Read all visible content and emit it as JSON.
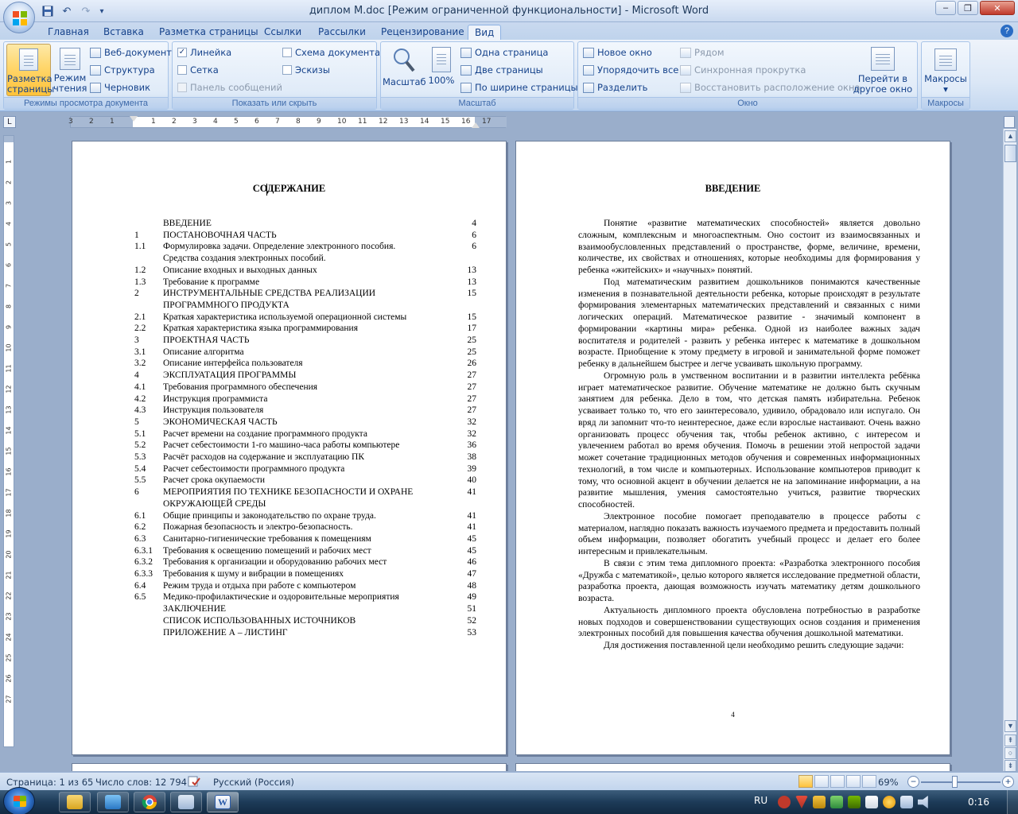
{
  "window": {
    "title": "диплом М.doc [Режим ограниченной функциональности] - Microsoft Word",
    "minimize": "–",
    "maximize": "❐",
    "close": "✕"
  },
  "quick_access": {
    "save_icon": "save-icon",
    "undo": "↶",
    "redo": "↷",
    "customize": "▾"
  },
  "tabs": [
    {
      "label": "Главная"
    },
    {
      "label": "Вставка"
    },
    {
      "label": "Разметка страницы"
    },
    {
      "label": "Ссылки"
    },
    {
      "label": "Рассылки"
    },
    {
      "label": "Рецензирование"
    },
    {
      "label": "Вид",
      "active": true
    }
  ],
  "ribbon": {
    "views": {
      "label": "Режимы просмотра документа",
      "print_layout_l1": "Разметка",
      "print_layout_l2": "страницы",
      "reading_l1": "Режим",
      "reading_l2": "чтения",
      "web": "Веб-документ",
      "outline": "Структура",
      "draft": "Черновик"
    },
    "show": {
      "label": "Показать или скрыть",
      "ruler": "Линейка",
      "ruler_checked": "✓",
      "grid": "Сетка",
      "message_bar": "Панель сообщений",
      "doc_map": "Схема документа",
      "thumbnails": "Эскизы"
    },
    "zoom": {
      "label": "Масштаб",
      "zoom": "Масштаб",
      "hundred": "100%",
      "one_page": "Одна страница",
      "two_pages": "Две страницы",
      "page_width": "По ширине страницы"
    },
    "window": {
      "label": "Окно",
      "new_window": "Новое окно",
      "arrange_all": "Упорядочить все",
      "split": "Разделить",
      "side_by_side": "Рядом",
      "sync_scroll": "Синхронная прокрутка",
      "reset_position": "Восстановить расположение окна",
      "switch_l1": "Перейти в",
      "switch_l2": "другое окно ▾"
    },
    "macros": {
      "label": "Макросы",
      "macros": "Макросы ▾"
    }
  },
  "ruler_corner": "L",
  "toc_page": {
    "title": "СОДЕРЖАНИЕ",
    "entries": [
      {
        "num": "",
        "text": "ВВЕДЕНИЕ",
        "page": "4"
      },
      {
        "num": "1",
        "text": "ПОСТАНОВОЧНАЯ ЧАСТЬ",
        "page": "6"
      },
      {
        "num": "1.1",
        "text": "Формулировка задачи. Определение электронного пособия.",
        "page": "6"
      },
      {
        "num": "",
        "text": "Средства создания электронных пособий.",
        "page": ""
      },
      {
        "num": "1.2",
        "text": "Описание входных и выходных данных",
        "page": "13"
      },
      {
        "num": "1.3",
        "text": "Требование к программе",
        "page": "13"
      },
      {
        "num": "2",
        "text": "ИНСТРУМЕНТАЛЬНЫЕ СРЕДСТВА РЕАЛИЗАЦИИ",
        "page": "15"
      },
      {
        "num": "",
        "text": "ПРОГРАММНОГО ПРОДУКТА",
        "page": ""
      },
      {
        "num": "2.1",
        "text": "Краткая характеристика используемой операционной  системы",
        "page": "15"
      },
      {
        "num": "2.2",
        "text": "Краткая характеристика языка программирования",
        "page": "17"
      },
      {
        "num": "3",
        "text": "ПРОЕКТНАЯ ЧАСТЬ",
        "page": "25"
      },
      {
        "num": "3.1",
        "text": "Описание алгоритма",
        "page": "25"
      },
      {
        "num": "3.2",
        "text": "Описание интерфейса пользователя",
        "page": "26"
      },
      {
        "num": "4",
        "text": "ЭКСПЛУАТАЦИЯ ПРОГРАММЫ",
        "page": "27"
      },
      {
        "num": "4.1",
        "text": "Требования программного обеспечения",
        "page": "27"
      },
      {
        "num": "4.2",
        "text": "Инструкция программиста",
        "page": "27"
      },
      {
        "num": "4.3",
        "text": "Инструкция пользователя",
        "page": "27"
      },
      {
        "num": "5",
        "text": "ЭКОНОМИЧЕСКАЯ ЧАСТЬ",
        "page": "32"
      },
      {
        "num": "5.1",
        "text": "Расчет времени на создание программного продукта",
        "page": "32"
      },
      {
        "num": "5.2",
        "text": "Расчет себестоимости 1-го машино-часа работы компьютере",
        "page": "36"
      },
      {
        "num": "5.3",
        "text": "Расчёт расходов на содержание и эксплуатацию ПК",
        "page": "38"
      },
      {
        "num": "5.4",
        "text": "Расчет себестоимости программного продукта",
        "page": "39"
      },
      {
        "num": "5.5",
        "text": "Расчет срока окупаемости",
        "page": "40"
      },
      {
        "num": "6",
        "text": "МЕРОПРИЯТИЯ ПО ТЕХНИКЕ БЕЗОПАСНОСТИ И ОХРАНЕ",
        "page": "41"
      },
      {
        "num": "",
        "text": "ОКРУЖАЮЩЕЙ СРЕДЫ",
        "page": ""
      },
      {
        "num": "6.1",
        "text": "Общие принципы  и законодательство по охране труда.",
        "page": "41"
      },
      {
        "num": "6.2",
        "text": "Пожарная безопасность и электро-безопасность.",
        "page": "41"
      },
      {
        "num": "6.3",
        "text": "Санитарно-гигиенические требования к помещениям",
        "page": "45"
      },
      {
        "num": "6.3.1",
        "text": "Требования к освещению помещений и рабочих мест",
        "page": "45"
      },
      {
        "num": "6.3.2",
        "text": "Требования к организации и оборудованию рабочих мест",
        "page": "46"
      },
      {
        "num": "6.3.3",
        "text": "Требования к шуму и вибрации в помещениях",
        "page": "47"
      },
      {
        "num": "6.4",
        "text": "Режим труда и отдыха при работе с компьютером",
        "page": "48"
      },
      {
        "num": "6.5",
        "text": "Медико-профилактические и оздоровительные мероприятия",
        "page": "49"
      },
      {
        "num": "",
        "text": "ЗАКЛЮЧЕНИЕ",
        "page": "51"
      },
      {
        "num": "",
        "text": "СПИСОК ИСПОЛЬЗОВАННЫХ ИСТОЧНИКОВ",
        "page": "52"
      },
      {
        "num": "",
        "text": "ПРИЛОЖЕНИЕ А – ЛИСТИНГ",
        "page": "53"
      }
    ]
  },
  "intro_page": {
    "title": "ВВЕДЕНИЕ",
    "paragraphs": [
      "Понятие «развитие математических способностей» является довольно сложным, комплексным и многоаспектным. Оно состоит из взаимосвязанных и взаимообусловленных представлений о пространстве, форме, величине, времени, количестве, их свойствах и отношениях, которые необходимы для формирования у ребенка «житейских» и «научных» понятий.",
      "Под математическим развитием дошкольников понимаются качественные изменения в познавательной деятельности ребенка, которые происходят в результате формирования элементарных математических представлений и связанных с ними логических операций. Математическое развитие - значимый компонент в формировании «картины мира» ребенка. Одной из наиболее важных задач воспитателя и родителей - развить у ребенка интерес к математике в дошкольном возрасте. Приобщение к этому предмету в игровой и занимательной форме поможет ребенку в дальнейшем быстрее и легче усваивать школьную программу.",
      "Огромную роль в умственном воспитании и в развитии интеллекта ребёнка играет математическое развитие. Обучение математике не должно быть скучным занятием для ребенка. Дело в том, что детская память избирательна. Ребенок усваивает только то, что его заинтересовало, удивило, обрадовало или испугало. Он вряд ли запомнит что-то неинтересное, даже если взрослые настаивают. Очень важно организовать процесс обучения так, чтобы ребенок активно, с интересом и увлечением работал во время обучения. Помочь в решении этой непростой задачи может сочетание традиционных методов обучения и современных информационных технологий, в том числе и компьютерных. Использование компьютеров приводит к тому, что основной акцент в обучении делается не на запоминание информации, а на развитие мышления, умения самостоятельно учиться, развитие творческих способностей.",
      "Электронное пособие помогает преподавателю в процессе работы с материалом, наглядно показать важность изучаемого предмета и предоставить полный объем информации, позволяет обогатить учебный процесс и делает его более интересным и привлекательным.",
      "В связи с этим тема дипломного проекта: «Разработка электронного пособия «Дружба с математикой», целью которого является исследование предметной области, разработка проекта, дающая возможность изучать математику детям дошкольного возраста.",
      "Актуальность дипломного проекта обусловлена потребностью в разработке новых подходов и совершенствовании существующих основ создания и применения электронных пособий для повышения качества обучения дошкольной математики.",
      "Для достижения поставленной цели необходимо решить следующие задачи:"
    ],
    "page_number": "4"
  },
  "statusbar": {
    "page": "Страница: 1 из 65",
    "words": "Число слов: 12 794",
    "language": "Русский (Россия)",
    "zoom": "69%",
    "zoom_level": 0.42,
    "zoom_minus": "−",
    "zoom_plus": "+"
  },
  "taskbar": {
    "language": "RU",
    "time": "0:16"
  }
}
